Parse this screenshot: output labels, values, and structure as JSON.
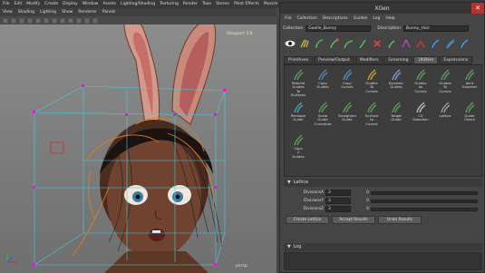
{
  "app_menu": [
    "File",
    "Edit",
    "Modify",
    "Create",
    "Display",
    "Window",
    "Assets",
    "Lighting/Shading",
    "Texturing",
    "Render",
    "Toon",
    "Stereo",
    "Paint Effects",
    "Muscle"
  ],
  "viewport_menu": [
    "View",
    "Shading",
    "Lighting",
    "Show",
    "Renderer",
    "Panels"
  ],
  "viewport": {
    "name_label": "Viewport 2.0",
    "camera_label": "persp"
  },
  "xgen": {
    "title": "XGen",
    "close_symbol": "✕",
    "menu": [
      "File",
      "Collection",
      "Descriptions",
      "Guides",
      "Log",
      "Help"
    ],
    "collection_label": "Collection",
    "collection_value": "Gaelle_Bunny",
    "description_label": "Description",
    "description_value": "Bunny_Hair",
    "tabs": [
      "Primitives",
      "Preview/Output",
      "Modifiers",
      "Grooming",
      "Utilities",
      "Expressions"
    ],
    "active_tab": "Utilities",
    "tools": [
      {
        "label": "Rebuild\nGuides\nTo\nSurfaces",
        "color": "#5aa05a"
      },
      {
        "label": "Copy\nGuides",
        "color": "#4a8fc0"
      },
      {
        "label": "Copy\nCurves",
        "color": "#4a8fc0"
      },
      {
        "label": "Guides\nTo\nCurves",
        "color": "#d0a030"
      },
      {
        "label": "Dynamic\nGuides",
        "color": "#7aa0d0"
      },
      {
        "label": "Guides\nAs\nCurves",
        "color": "#5aa05a"
      },
      {
        "label": "Guides\nTo\nCurves",
        "color": "#5aa05a"
      },
      {
        "label": "Joint\nGroomer",
        "color": "#5aa05a"
      },
      {
        "label": "Reshape\nGuide",
        "color": "#4aa0c0"
      },
      {
        "label": "Scale\nGuide\nCurvature",
        "color": "#5aa05a"
      },
      {
        "label": "Straighten\nGuide",
        "color": "#5aa05a"
      },
      {
        "label": "Surface\nto\nCurves",
        "color": "#5aa05a"
      },
      {
        "label": "Target\nGuide",
        "color": "#5aa05a"
      },
      {
        "label": "CV\nSelection",
        "color": "#c0c0c0"
      },
      {
        "label": "Lattice",
        "color": "#a0a0a0"
      },
      {
        "label": "Guide\nCheck",
        "color": "#5aa05a"
      },
      {
        "label": "Caps\n2\nGuides",
        "color": "#5aa05a"
      }
    ],
    "lattice": {
      "section_title": "Lattice",
      "rows": [
        {
          "label": "DivisionsX",
          "value": "3",
          "slider_value": "0"
        },
        {
          "label": "DivisionsY",
          "value": "3",
          "slider_value": "0"
        },
        {
          "label": "DivisionsZ",
          "value": "3",
          "slider_value": "0"
        }
      ],
      "buttons": {
        "create": "Create Lattice",
        "accept": "Accept Results",
        "undo": "Undo Results"
      }
    },
    "log_title": "Log"
  }
}
